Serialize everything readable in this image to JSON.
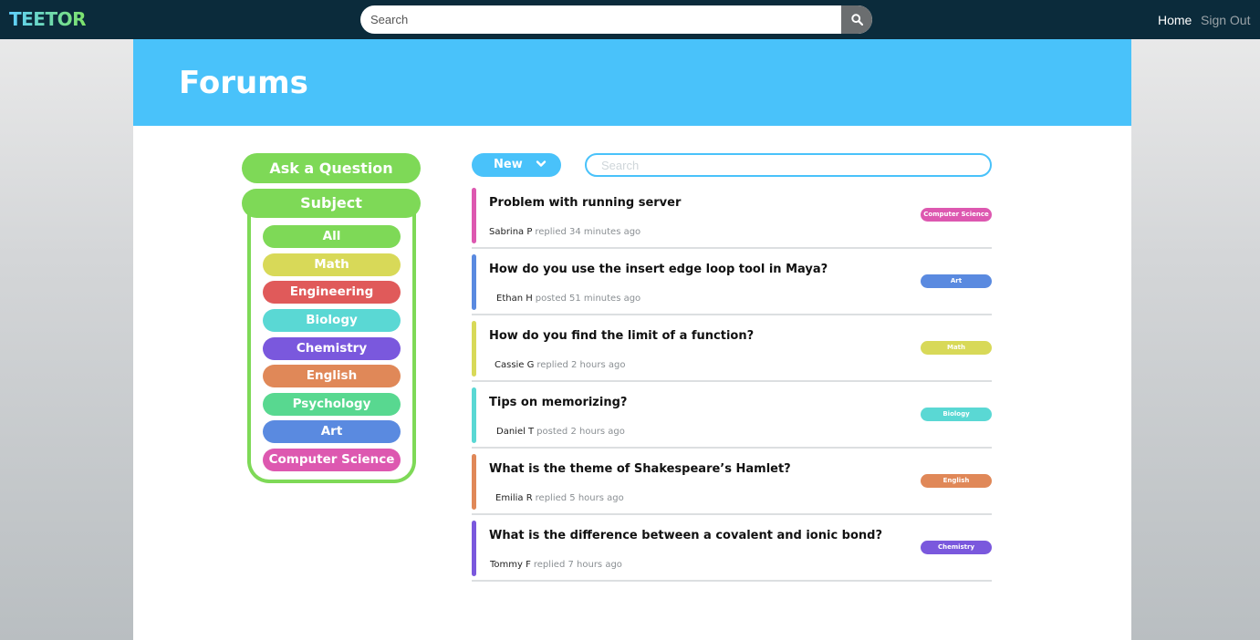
{
  "app": {
    "logo": "TEETOR"
  },
  "topnav": {
    "search_placeholder": "Search",
    "home_label": "Home",
    "signout_label": "Sign Out"
  },
  "page": {
    "title": "Forums"
  },
  "sidebar": {
    "ask_label": "Ask a Question",
    "subject_label": "Subject",
    "subjects": [
      {
        "label": "All",
        "color": "#7ed957"
      },
      {
        "label": "Math",
        "color": "#d8d958"
      },
      {
        "label": "Engineering",
        "color": "#e05a5a"
      },
      {
        "label": "Biology",
        "color": "#5ad8d4"
      },
      {
        "label": "Chemistry",
        "color": "#7a58dd"
      },
      {
        "label": "English",
        "color": "#e08858"
      },
      {
        "label": "Psychology",
        "color": "#58d890"
      },
      {
        "label": "Art",
        "color": "#5a8ae0"
      },
      {
        "label": "Computer Science",
        "color": "#dd58b0"
      }
    ]
  },
  "toolbar": {
    "sort_label": "New",
    "search_placeholder": "Search"
  },
  "posts": [
    {
      "title": "Problem with running server",
      "author": "Sabrina P",
      "activity": "replied 34 minutes ago",
      "tag": "Computer Science",
      "color": "#dd58b0"
    },
    {
      "title": "How do you use the insert edge loop tool in Maya?",
      "author": "Ethan H",
      "activity": "posted 51 minutes ago",
      "tag": "Art",
      "color": "#5a8ae0"
    },
    {
      "title": "How do you find the limit of a function?",
      "author": "Cassie G",
      "activity": "replied 2 hours ago",
      "tag": "Math",
      "color": "#d8d958"
    },
    {
      "title": "Tips on memorizing?",
      "author": "Daniel T",
      "activity": "posted 2 hours ago",
      "tag": "Biology",
      "color": "#5ad8d4"
    },
    {
      "title": "What is the theme of Shakespeare’s Hamlet?",
      "author": "Emilia R",
      "activity": "replied 5 hours ago",
      "tag": "English",
      "color": "#e08858"
    },
    {
      "title": "What is the difference between a covalent and ionic bond?",
      "author": "Tommy F",
      "activity": "replied 7 hours ago",
      "tag": "Chemistry",
      "color": "#7a58dd"
    }
  ]
}
